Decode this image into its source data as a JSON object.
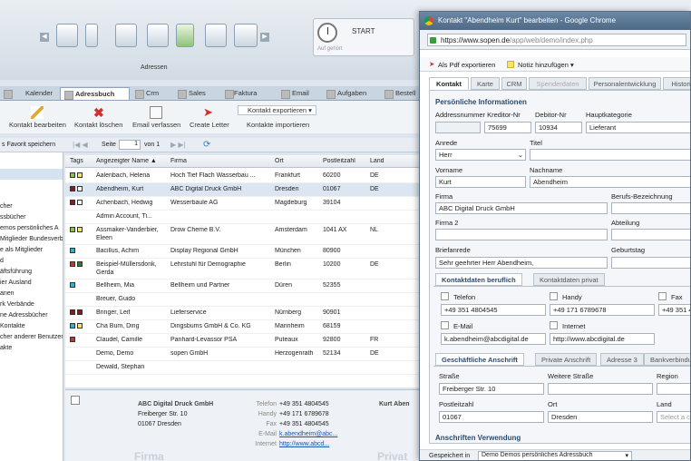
{
  "toolbar_top": {
    "section_label": "Adressen",
    "start_label": "START",
    "status_text": "Auf gehört"
  },
  "tabs": [
    {
      "label": "Kalender",
      "active": false
    },
    {
      "label": "Adressbuch",
      "active": true
    },
    {
      "label": "Crm",
      "active": false
    },
    {
      "label": "Sales",
      "active": false
    },
    {
      "label": "Faktura",
      "active": false
    },
    {
      "label": "Email",
      "active": false
    },
    {
      "label": "Aufgaben",
      "active": false
    },
    {
      "label": "Bestell",
      "active": false
    }
  ],
  "actions": {
    "edit": "Kontakt bearbeiten",
    "delete": "Kontakt löschen",
    "email": "Email verfassen",
    "letter": "Create Letter",
    "export": "Kontakt exportieren",
    "import": "Kontakte importieren"
  },
  "pager": {
    "save_favorite": "s Favorit speichern",
    "page_label": "Seite",
    "page_value": "1",
    "of_label": "von 1"
  },
  "left_nav": [
    "cher",
    "ssbücher",
    "emos persönliches A",
    "Mitglieder Bundesverb",
    "e als Mitglieder",
    "d",
    "äftsführung",
    "ier Ausland",
    "anen",
    "rk Verbände",
    "ne Adressbücher",
    "Kontakte",
    "cher anderer Benutzer",
    "akte"
  ],
  "grid": {
    "headers": {
      "tags": "Tags",
      "name": "Angezeigter Name ▲",
      "company": "Firma",
      "city": "Ort",
      "zip": "Postleitzahl",
      "country": "Land"
    },
    "rows": [
      {
        "tags": [
          "#8bc34a",
          "#f5e663"
        ],
        "name": "Aalenbach, Helena",
        "company": "Hoch Tief Flach Wasserbau ...",
        "city": "Frankfurt",
        "zip": "60200",
        "country": "DE",
        "selected": false
      },
      {
        "tags": [
          "#8b1a1a",
          "#ffffff"
        ],
        "name": "Abendheim, Kurt",
        "company": "ABC Digital Druck GmbH",
        "city": "Dresden",
        "zip": "01067",
        "country": "DE",
        "selected": true
      },
      {
        "tags": [
          "#8b1a1a",
          "#ffffff"
        ],
        "name": "Achenbach, Hedwig",
        "company": "Wesserbaule AG",
        "city": "Magdeburg",
        "zip": "39104",
        "country": "",
        "selected": false
      },
      {
        "tags": [],
        "name": "Admin Account, Ti...",
        "company": "",
        "city": "",
        "zip": "",
        "country": "",
        "selected": false
      },
      {
        "tags": [
          "#8bc34a",
          "#f5e663"
        ],
        "name": "Assmaker-Vanderbier, Eleen",
        "company": "Drow Cheme B.V.",
        "city": "Amsterdam",
        "zip": "1041 AX",
        "country": "NL",
        "selected": false
      },
      {
        "tags": [
          "#29b6d6"
        ],
        "name": "Bacillus, Achim",
        "company": "Display Regional GmbH",
        "city": "München",
        "zip": "80900",
        "country": "",
        "selected": false
      },
      {
        "tags": [
          "#c0392b",
          "#2e7d32"
        ],
        "name": "Beispiel-Müllersdonk, Gerda",
        "company": "Lehrstuhl für Demographie",
        "city": "Berlin",
        "zip": "10200",
        "country": "DE",
        "selected": false
      },
      {
        "tags": [
          "#29b6d6"
        ],
        "name": "Bellheim, Mia",
        "company": "Bellheim und Partner",
        "city": "Düren",
        "zip": "52355",
        "country": "",
        "selected": false
      },
      {
        "tags": [],
        "name": "Breuer, Guido",
        "company": "",
        "city": "",
        "zip": "",
        "country": "",
        "selected": false
      },
      {
        "tags": [
          "#8b1a1a",
          "#8b1a1a"
        ],
        "name": "Bringer, Leif",
        "company": "Lieferservice",
        "city": "Nürnberg",
        "zip": "90901",
        "country": "",
        "selected": false
      },
      {
        "tags": [
          "#29b6d6",
          "#f5e663"
        ],
        "name": "Cha Bum, Ding",
        "company": "Dingsbums GmbH & Co. KG",
        "city": "Mannheim",
        "zip": "68159",
        "country": "",
        "selected": false
      },
      {
        "tags": [
          "#c0392b"
        ],
        "name": "Claudel, Camille",
        "company": "Panhard-Levassor PSA",
        "city": "Puteaux",
        "zip": "92800",
        "country": "FR",
        "selected": false
      },
      {
        "tags": [],
        "name": "Demo, Demo",
        "company": "sopen GmbH",
        "city": "Herzogenrath",
        "zip": "52134",
        "country": "DE",
        "selected": false
      },
      {
        "tags": [],
        "name": "Dewald, Stephan",
        "company": "",
        "city": "",
        "zip": "",
        "country": "",
        "selected": false
      }
    ]
  },
  "detail": {
    "company": "ABC Digital Druck GmbH",
    "street": "Freiberger Str. 10",
    "city": "01067 Dresden",
    "labels": {
      "phone": "Telefon",
      "mobile": "Handy",
      "fax": "Fax",
      "email": "E-Mail",
      "web": "Internet"
    },
    "phone": "+49 351 4804545",
    "mobile": "+49 171 6789678",
    "fax": "+49 351 4804545",
    "email": "k.abendheim@abc...",
    "web": "http://www.abcd...",
    "section_firma": "Firma",
    "section_privat": "Privat",
    "right_name": "Kurt Aben"
  },
  "popup": {
    "title": "Kontakt \"Abendheim Kurt\" bearbeiten - Google Chrome",
    "url": "https://www.sopen.de/app/web/demo/index.php",
    "url_prefix": "https://www.sopen.de",
    "url_rest": "/app/web/demo/index.php",
    "pdf_export": "Als Pdf exportieren",
    "add_note": "Notiz hinzufügen",
    "tabs": [
      {
        "label": "Kontakt",
        "state": "active"
      },
      {
        "label": "Karte",
        "state": "normal"
      },
      {
        "label": "CRM",
        "state": "normal"
      },
      {
        "label": "Spenderdaten",
        "state": "disabled"
      },
      {
        "label": "Personalentwicklung",
        "state": "normal"
      },
      {
        "label": "Histori",
        "state": "normal"
      }
    ],
    "section_personal": "Persönliche Informationen",
    "labels": {
      "adr_nr": "Addressnummer Kreditor-Nr",
      "debitor": "Debitor-Nr",
      "hauptkategorie": "Hauptkategorie",
      "anrede": "Anrede",
      "titel": "Titel",
      "vorname": "Vorname",
      "nachname": "Nachname",
      "firma": "Firma",
      "berufs": "Berufs-Bezeichnung",
      "firma2": "Firma 2",
      "abteilung": "Abteilung",
      "briefanrede": "Briefanrede",
      "geburtstag": "Geburtstag",
      "telefon": "Telefon",
      "handy": "Handy",
      "fax": "Fax",
      "email": "E-Mail",
      "internet": "Internet",
      "strasse": "Straße",
      "weitere_strasse": "Weitere Straße",
      "region": "Region",
      "plz": "Postleitzahl",
      "ort": "Ort",
      "land": "Land"
    },
    "values": {
      "kreditor": "75699",
      "debitor": "10934",
      "hauptkategorie": "Lieferant",
      "anrede": "Herr",
      "vorname": "Kurt",
      "nachname": "Abendheim",
      "firma": "ABC Digital Druck GmbH",
      "briefanrede": "Sehr geehrter Herr Abendheim,",
      "telefon": "+49 351 4804545",
      "handy": "+49 171 6789678",
      "fax": "+49 351 4",
      "email": "k.abendheim@abcdigital.de",
      "internet": "http://www.abcdigital.de",
      "strasse": "Freiberger Str. 10",
      "plz": "01067",
      "ort": "Dresden",
      "land_placeholder": "Select a co"
    },
    "contact_tabs": [
      "Kontaktdaten beruflich",
      "Kontaktdaten privat"
    ],
    "address_tabs": [
      "Geschäftliche Anschrift",
      "Private Anschrift",
      "Adresse 3",
      "Bankverbindu"
    ],
    "section_shipping": "Anschriften Verwendung",
    "footer_label": "Gespeichert in",
    "footer_value": "Demo Demos persönliches Adressbuch"
  }
}
